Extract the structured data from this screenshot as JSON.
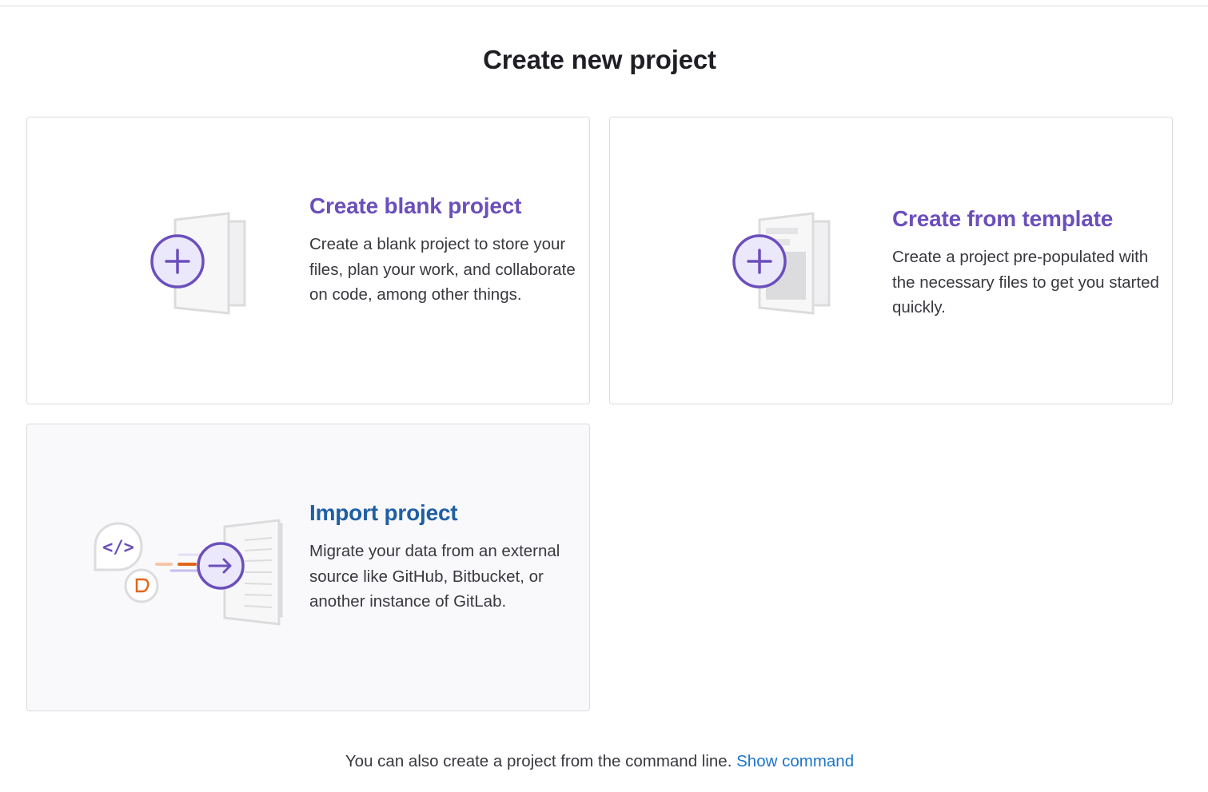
{
  "page": {
    "title": "Create new project"
  },
  "cards": {
    "blank": {
      "title": "Create blank project",
      "description": "Create a blank project to store your files, plan your work, and collaborate on code, among other things.",
      "icon": "plus-document-icon"
    },
    "template": {
      "title": "Create from template",
      "description": "Create a project pre-populated with the necessary files to get you started quickly.",
      "icon": "template-document-icon"
    },
    "import": {
      "title": "Import project",
      "description": "Migrate your data from an external source like GitHub, Bitbucket, or another instance of GitLab.",
      "icon": "import-document-icon"
    }
  },
  "footer": {
    "text": "You can also create a project from the command line.",
    "link_label": "Show command"
  },
  "colors": {
    "accent_purple": "#6b4fbb",
    "link_blue": "#1f75cb",
    "import_title_blue": "#1f5fa3",
    "orange": "#e2661c"
  }
}
